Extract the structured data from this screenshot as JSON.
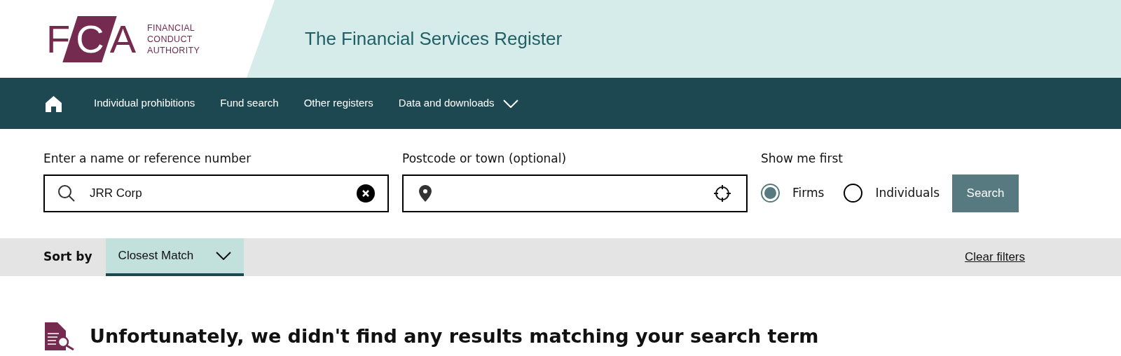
{
  "header": {
    "logo": {
      "mark": "FCA",
      "lines": [
        "FINANCIAL",
        "CONDUCT",
        "AUTHORITY"
      ]
    },
    "title": "The Financial Services Register"
  },
  "nav": {
    "items": [
      {
        "label": "Individual prohibitions",
        "has_menu": false
      },
      {
        "label": "Fund search",
        "has_menu": false
      },
      {
        "label": "Other registers",
        "has_menu": false
      },
      {
        "label": "Data and downloads",
        "has_menu": true
      }
    ]
  },
  "search": {
    "name_field": {
      "label": "Enter a name or reference number",
      "value": "JRR Corp"
    },
    "location_field": {
      "label": "Postcode or town (optional)"
    },
    "show_me_first": {
      "label": "Show me first",
      "options": [
        {
          "label": "Firms",
          "selected": true
        },
        {
          "label": "Individuals",
          "selected": false
        }
      ]
    },
    "button": "Search"
  },
  "sort_bar": {
    "label": "Sort by",
    "value": "Closest Match",
    "clear": "Clear filters"
  },
  "message": "Unfortunately, we didn't find any results matching your search term"
}
